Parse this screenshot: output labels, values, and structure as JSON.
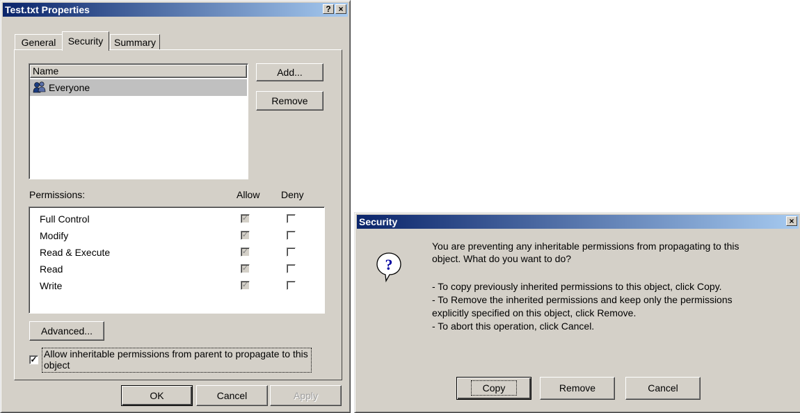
{
  "props_dialog": {
    "title": "Test.txt Properties",
    "help_btn": "?",
    "close_btn": "×",
    "tabs": [
      "General",
      "Security",
      "Summary"
    ],
    "name_header": "Name",
    "users": [
      "Everyone"
    ],
    "add_btn": "Add...",
    "remove_btn": "Remove",
    "permissions_label": "Permissions:",
    "allow_header": "Allow",
    "deny_header": "Deny",
    "permissions": [
      {
        "name": "Full Control",
        "allow": true,
        "deny": false
      },
      {
        "name": "Modify",
        "allow": true,
        "deny": false
      },
      {
        "name": "Read & Execute",
        "allow": true,
        "deny": false
      },
      {
        "name": "Read",
        "allow": true,
        "deny": false
      },
      {
        "name": "Write",
        "allow": true,
        "deny": false
      }
    ],
    "advanced_btn": "Advanced...",
    "inherit_label_1": "Allow inheritable permissions from parent to propagate to this",
    "inherit_label_2": "object",
    "inherit_checked": true,
    "ok_btn": "OK",
    "cancel_btn": "Cancel",
    "apply_btn": "Apply"
  },
  "security_dialog": {
    "title": "Security",
    "close_btn": "×",
    "line1": "You are preventing any inheritable permissions from propagating to this",
    "line2": "object.  What do you want to do?",
    "line3": "- To copy previously inherited permissions to this object, click Copy.",
    "line4": "- To Remove the inherited permissions and keep only the permissions",
    "line5": "explicitly specified on this object, click Remove.",
    "line6": "- To abort this operation, click Cancel.",
    "copy_btn": "Copy",
    "remove_btn": "Remove",
    "cancel_btn": "Cancel"
  }
}
